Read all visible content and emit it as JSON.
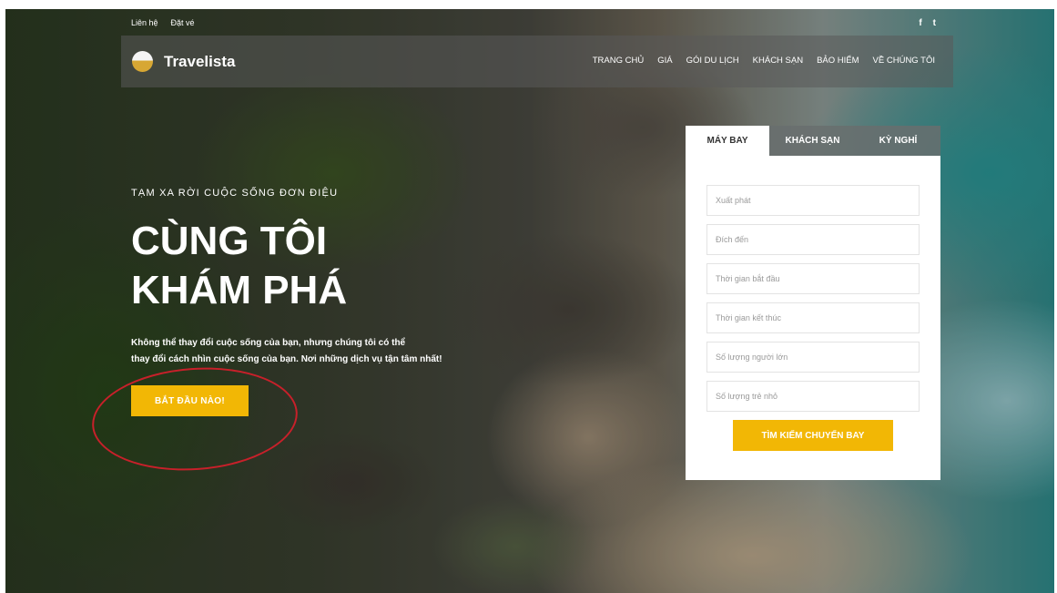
{
  "topbar": {
    "links": [
      "Liên hệ",
      "Đặt vé"
    ],
    "social": [
      "f",
      "t"
    ]
  },
  "nav": {
    "brand": "Travelista",
    "items": [
      "TRANG CHỦ",
      "GIÁ",
      "GÓI DU LỊCH",
      "KHÁCH SẠN",
      "BẢO HIỂM",
      "VỀ CHÚNG TÔI"
    ]
  },
  "hero": {
    "tagline": "TẠM XA RỜI CUỘC SỐNG ĐƠN ĐIỆU",
    "headline_line1": "CÙNG TÔI",
    "headline_line2": "KHÁM PHÁ",
    "description_line1": "Không thể thay đổi cuộc sống của bạn, nhưng chúng tôi có thể",
    "description_line2": "thay đổi cách nhìn cuộc sống của bạn. Nơi những dịch vụ tận tâm nhất!",
    "cta": "BẮT ĐẦU NÀO!"
  },
  "booking": {
    "tabs": [
      "MÁY BAY",
      "KHÁCH SẠN",
      "KỲ NGHỈ"
    ],
    "active_tab": "MÁY BAY",
    "fields": [
      "Xuất phát",
      "Đích đến",
      "Thời gian bắt đầu",
      "Thời gian kết thúc",
      "Số lượng người lớn",
      "Số lượng trẻ nhỏ"
    ],
    "search_button": "TÌM KIẾM CHUYẾN BAY"
  },
  "colors": {
    "accent": "#f2b705",
    "annotation": "#c8202a"
  }
}
